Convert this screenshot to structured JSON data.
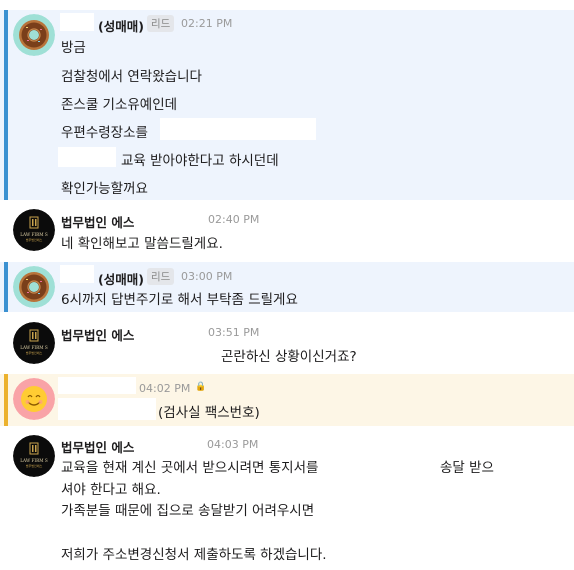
{
  "messages": [
    {
      "sender": "(성매매)",
      "tag": "리드",
      "time": "02:21 PM",
      "lines": [
        "방금",
        "검찰청에서 연락왔습니다",
        "존스쿨 기소유예인데",
        "우편수령장소를",
        "교육 받아야한다고 하시던데",
        "확인가능할꺼요"
      ]
    },
    {
      "sender": "법무법인 에스",
      "time": "02:40 PM",
      "lines": [
        "네 확인해보고 말씀드릴게요."
      ]
    },
    {
      "sender": "(성매매)",
      "tag": "리드",
      "time": "03:00 PM",
      "lines": [
        "6시까지 답변주기로 해서 부탁좀 드릴게요"
      ]
    },
    {
      "sender": "법무법인 에스",
      "time": "03:51 PM",
      "lines": [
        "곤란하신 상황이신거죠?"
      ]
    },
    {
      "time": "04:02 PM",
      "lines": [
        "(검사실 팩스번호)"
      ]
    },
    {
      "sender": "법무법인 에스",
      "time": "04:03 PM",
      "lines": [
        "교육을 현재 계신 곳에서 받으시려면 통지서를",
        "송달 받으",
        "셔야 한다고 해요.",
        "가족분들 때문에 집으로 송달받기 어려우시면",
        "저희가 주소변경신청서 제출하도록 하겠습니다."
      ]
    }
  ],
  "logo": {
    "line1": "LAW FIRM S",
    "line2": "법무법인에스"
  },
  "colors": {
    "highlight_blue": "#eef4fd",
    "bar_blue": "#3b91d1",
    "highlight_yellow": "#fdf6e6",
    "bar_yellow": "#ecb22e"
  },
  "icons": {
    "donut": "donut-avatar-icon",
    "smile": "smile-avatar-icon",
    "law": "law-firm-logo-icon",
    "lock": "lock-icon"
  }
}
